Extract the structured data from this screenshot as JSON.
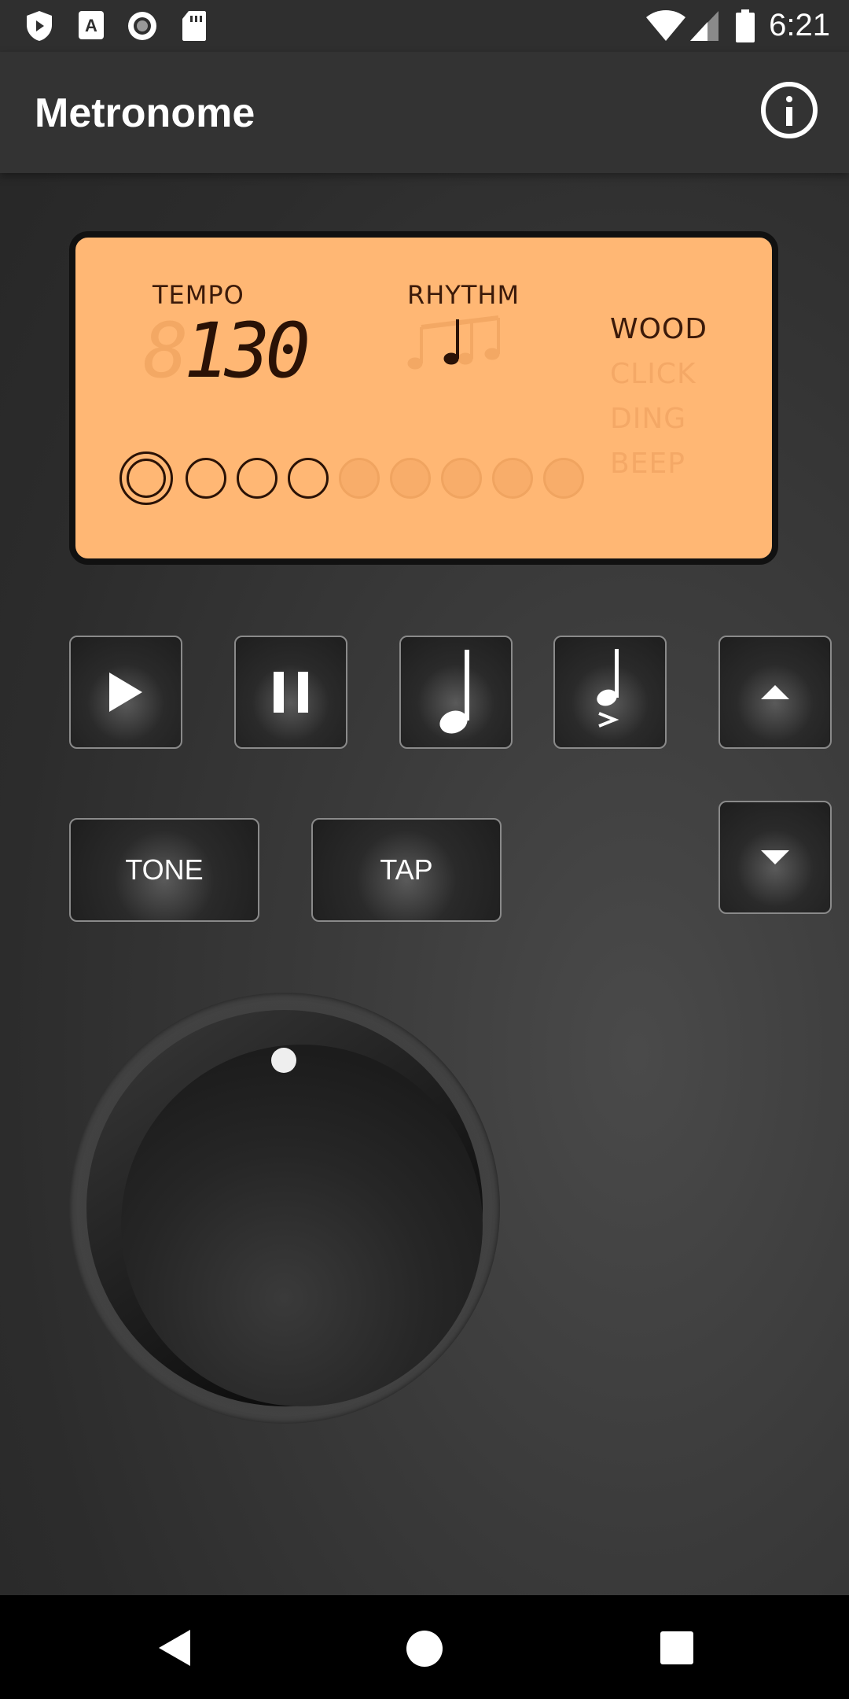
{
  "status_bar": {
    "time": "6:21",
    "icons": [
      "shield-icon",
      "text-a-icon",
      "record-icon",
      "sd-card-icon",
      "wifi-icon",
      "cell-signal-icon",
      "battery-icon"
    ]
  },
  "app_bar": {
    "title": "Metronome",
    "info_icon": "info-icon"
  },
  "display": {
    "tempo_label": "TEMPO",
    "tempo_value": "130",
    "tempo_ghost_digit": "8",
    "rhythm_label": "RHYTHM",
    "rhythm_selected": "quarter-note",
    "sounds": [
      {
        "label": "WOOD",
        "active": true
      },
      {
        "label": "CLICK",
        "active": false
      },
      {
        "label": "DING",
        "active": false
      },
      {
        "label": "BEEP",
        "active": false
      }
    ],
    "beats_total": 9,
    "beats_active": 4,
    "current_beat": 1
  },
  "controls": {
    "play_icon": "play-icon",
    "pause_icon": "pause-icon",
    "note_icon": "quarter-note-icon",
    "accent_icon": "accent-note-icon",
    "up_icon": "triangle-up-icon",
    "down_icon": "triangle-down-icon",
    "tone_label": "TONE",
    "tap_label": "TAP"
  },
  "colors": {
    "lcd_background": "#ffb774",
    "lcd_text": "#3b1a0a",
    "lcd_inactive": "#f4a866"
  },
  "nav_bar": {
    "icons": [
      "back-icon",
      "home-icon",
      "recents-icon"
    ]
  }
}
